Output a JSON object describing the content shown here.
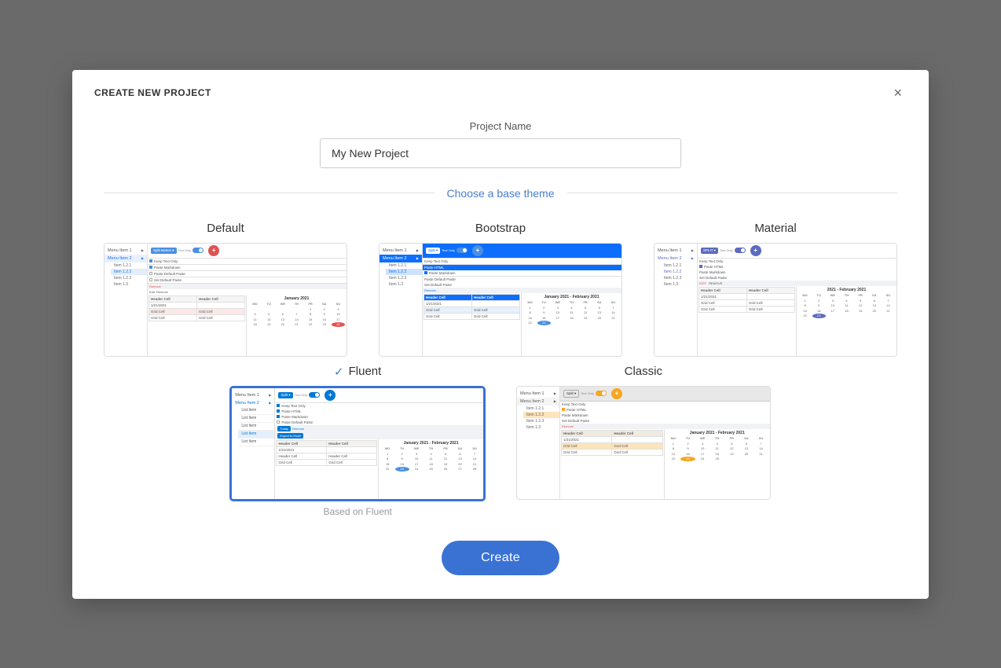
{
  "modal": {
    "title": "CREATE NEW PROJECT",
    "close_label": "×"
  },
  "form": {
    "project_name_label": "Project Name",
    "project_name_value": "My New Project",
    "project_name_placeholder": "My New Project"
  },
  "theme_section": {
    "divider_text": "Choose a base theme"
  },
  "themes": [
    {
      "id": "default",
      "label": "Default",
      "selected": false,
      "based_on": ""
    },
    {
      "id": "bootstrap",
      "label": "Bootstrap",
      "selected": false,
      "based_on": ""
    },
    {
      "id": "material",
      "label": "Material",
      "selected": false,
      "based_on": ""
    },
    {
      "id": "fluent",
      "label": "Fluent",
      "selected": true,
      "based_on": "Based on Fluent"
    },
    {
      "id": "classic",
      "label": "Classic",
      "selected": false,
      "based_on": ""
    }
  ],
  "actions": {
    "create_label": "Create"
  }
}
